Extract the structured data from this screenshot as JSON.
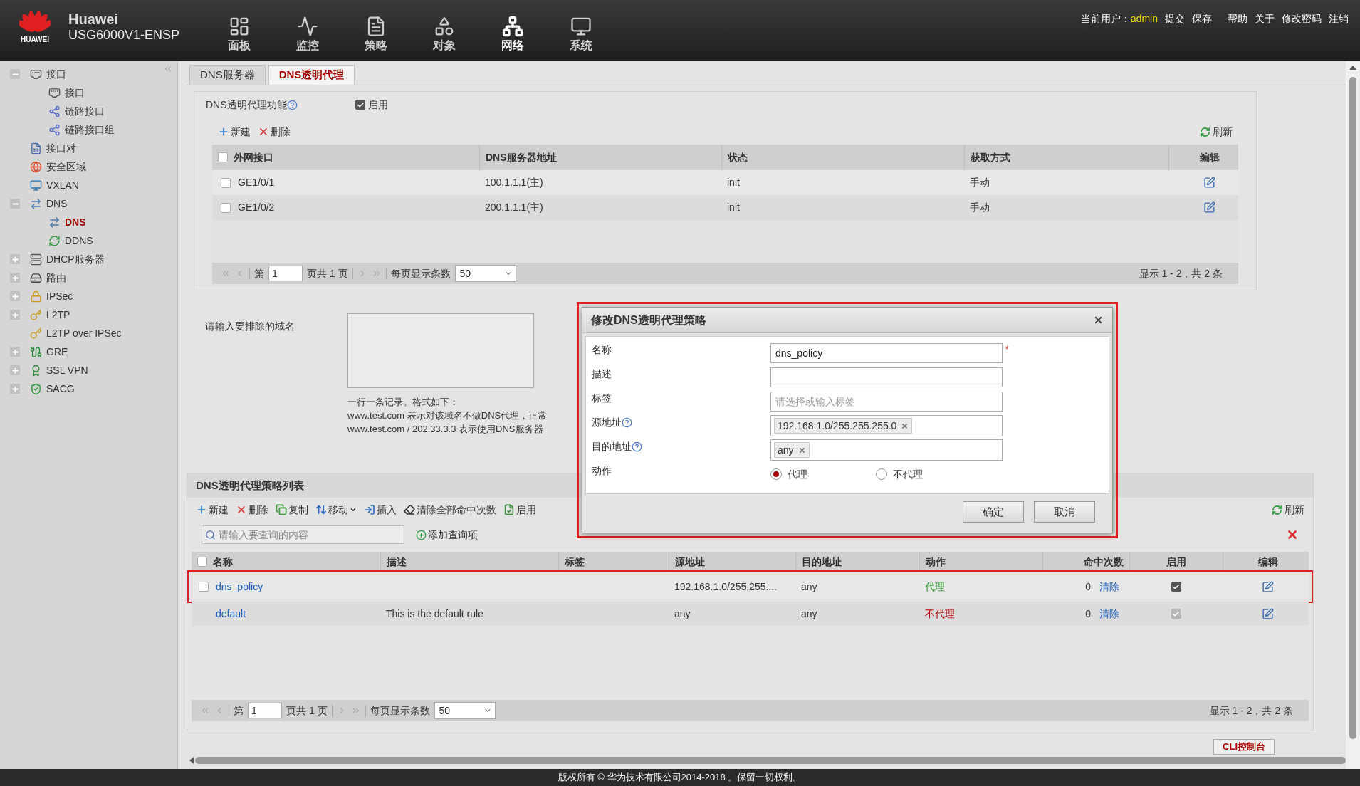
{
  "header": {
    "logo_text": "HUAWEI",
    "brand": "Huawei",
    "model": "USG6000V1-ENSP",
    "nav": [
      {
        "label": "面板",
        "selected": false
      },
      {
        "label": "监控",
        "selected": false
      },
      {
        "label": "策略",
        "selected": false
      },
      {
        "label": "对象",
        "selected": false
      },
      {
        "label": "网络",
        "selected": true
      },
      {
        "label": "系统",
        "selected": false
      }
    ],
    "user_label": "当前用户：",
    "user": "admin",
    "links": [
      "提交",
      "保存",
      "帮助",
      "关于",
      "修改密码",
      "注销"
    ]
  },
  "sidebar": {
    "items": [
      {
        "label": "接口",
        "expanded": true,
        "selected": false,
        "children": [
          {
            "label": "接口",
            "selected": false
          },
          {
            "label": "链路接口",
            "selected": false
          },
          {
            "label": "链路接口组",
            "selected": false
          }
        ]
      },
      {
        "label": "接口对",
        "selected": false
      },
      {
        "label": "安全区域",
        "selected": false
      },
      {
        "label": "VXLAN",
        "selected": false
      },
      {
        "label": "DNS",
        "expanded": true,
        "selected": false,
        "children": [
          {
            "label": "DNS",
            "selected": true
          },
          {
            "label": "DDNS",
            "selected": false
          }
        ]
      },
      {
        "label": "DHCP服务器",
        "expanded": false,
        "selected": false
      },
      {
        "label": "路由",
        "expanded": false,
        "selected": false
      },
      {
        "label": "IPSec",
        "expanded": false,
        "selected": false
      },
      {
        "label": "L2TP",
        "expanded": false,
        "selected": false
      },
      {
        "label": "L2TP over IPSec",
        "selected": false
      },
      {
        "label": "GRE",
        "expanded": false,
        "selected": false
      },
      {
        "label": "SSL VPN",
        "expanded": false,
        "selected": false
      },
      {
        "label": "SACG",
        "expanded": false,
        "selected": false
      }
    ]
  },
  "tabs": [
    {
      "label": "DNS服务器",
      "selected": false
    },
    {
      "label": "DNS透明代理",
      "selected": true
    }
  ],
  "proxy_function": {
    "label": "DNS透明代理功能",
    "option": "启用",
    "checked": true
  },
  "server_table": {
    "toolbar": [
      "新建",
      "删除"
    ],
    "refresh": "刷新",
    "header_checked": false,
    "columns": [
      "外网接口",
      "DNS服务器地址",
      "状态",
      "获取方式",
      "编辑"
    ],
    "rows": [
      {
        "checked": false,
        "interface": "GE1/0/1",
        "server": "100.1.1.1(主)",
        "status": "init",
        "method": "手动"
      },
      {
        "checked": false,
        "interface": "GE1/0/2",
        "server": "200.1.1.1(主)",
        "status": "init",
        "method": "手动"
      }
    ],
    "pager": {
      "page_prefix": "第",
      "page": "1",
      "page_suffix": "页共 1 页",
      "per_page_label": "每页显示条数",
      "per_page": "50",
      "summary": "显示 1 - 2，共 2 条"
    }
  },
  "exclude": {
    "label": "请输入要排除的域名",
    "hints": [
      "一行一条记录。格式如下：",
      "www.test.com 表示对该域名不做DNS代理，正常",
      "www.test.com / 202.33.3.3 表示使用DNS服务器"
    ]
  },
  "policy_list": {
    "title": "DNS透明代理策略列表",
    "toolbar": [
      "新建",
      "删除",
      "复制",
      "移动",
      "插入",
      "清除全部命中次数",
      "启用"
    ],
    "refresh": "刷新",
    "search_placeholder": "请输入要查询的内容",
    "add_query": "添加查询项",
    "header_checked": false,
    "columns": [
      "名称",
      "描述",
      "标签",
      "源地址",
      "目的地址",
      "动作",
      "命中次数",
      "启用",
      "编辑"
    ],
    "rows": [
      {
        "checked": false,
        "annotated": true,
        "name": "dns_policy",
        "description": "",
        "tag": "",
        "source": "192.168.1.0/255.255....",
        "destination": "any",
        "action": "代理",
        "color": "#2a9a2a",
        "hits": "0",
        "clear": "清除",
        "enabled": true,
        "disabled": false
      },
      {
        "annotated": false,
        "name": "default",
        "description": "This is the default rule",
        "tag": "",
        "source": "any",
        "destination": "any",
        "action": "不代理",
        "color": "#b00000",
        "hits": "0",
        "clear": "清除",
        "enabled": true,
        "disabled": true
      }
    ],
    "pager": {
      "page_prefix": "第",
      "page": "1",
      "page_suffix": "页共 1 页",
      "per_page_label": "每页显示条数",
      "per_page": "50",
      "summary": "显示 1 - 2，共 2 条"
    }
  },
  "dialog": {
    "title": "修改DNS透明代理策略",
    "annotated": true,
    "fields": [
      {
        "kind": "text",
        "label": "名称",
        "value": "dns_policy",
        "required_mark": "*"
      },
      {
        "kind": "text",
        "label": "描述"
      },
      {
        "kind": "text",
        "label": "标签",
        "placeholder": "请选择或输入标签"
      },
      {
        "kind": "tags",
        "label": "源地址",
        "help": true,
        "tags": [
          "192.168.1.0/255.255.255.0"
        ]
      },
      {
        "kind": "tags",
        "label": "目的地址",
        "help": true,
        "tags": [
          "any"
        ]
      },
      {
        "kind": "radio",
        "label": "动作",
        "options": [
          {
            "label": "代理",
            "selected": true
          },
          {
            "label": "不代理",
            "selected": false
          }
        ]
      }
    ],
    "buttons": [
      "确定",
      "取消"
    ]
  },
  "cli_button": "CLI控制台",
  "footer": "版权所有 © 华为技术有限公司2014-2018 。保留一切权利。"
}
